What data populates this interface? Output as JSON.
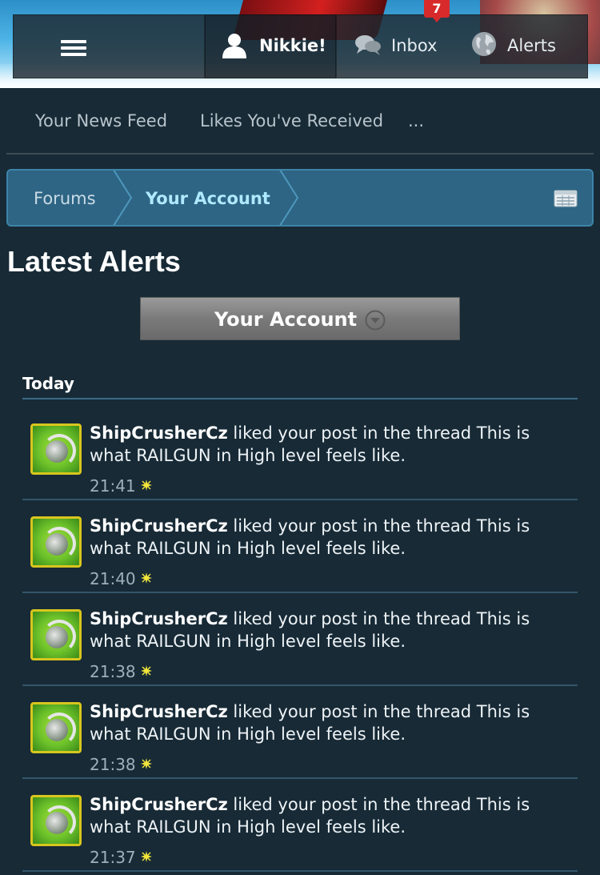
{
  "header": {
    "user_name": "Nikkie!",
    "inbox_label": "Inbox",
    "inbox_badge": "7",
    "alerts_label": "Alerts",
    "icons": [
      "menu-icon",
      "user-icon",
      "inbox-icon",
      "alerts-globe-icon"
    ]
  },
  "tabs": {
    "news_feed": "Your News Feed",
    "likes": "Likes You've Received",
    "more": "..."
  },
  "breadcrumb": {
    "forums": "Forums",
    "account": "Your Account"
  },
  "page": {
    "title": "Latest Alerts",
    "filter_value": "Your Account"
  },
  "section": {
    "heading": "Today"
  },
  "alerts": [
    {
      "user": "ShipCrusherCz",
      "text": " liked your post in the thread This is what RAILGUN in High level feels like.",
      "time": "21:41"
    },
    {
      "user": "ShipCrusherCz",
      "text": " liked your post in the thread This is what RAILGUN in High level feels like.",
      "time": "21:40"
    },
    {
      "user": "ShipCrusherCz",
      "text": " liked your post in the thread This is what RAILGUN in High level feels like.",
      "time": "21:38"
    },
    {
      "user": "ShipCrusherCz",
      "text": " liked your post in the thread This is what RAILGUN in High level feels like.",
      "time": "21:38"
    },
    {
      "user": "ShipCrusherCz",
      "text": " liked your post in the thread This is what RAILGUN in High level feels like.",
      "time": "21:37"
    }
  ],
  "colors": {
    "background": "#172a36",
    "breadcrumb_bg": "#2e6584",
    "badge_red": "#d82a2a",
    "crumb_active": "#aee9ff",
    "new_star": "#f2e53a"
  }
}
